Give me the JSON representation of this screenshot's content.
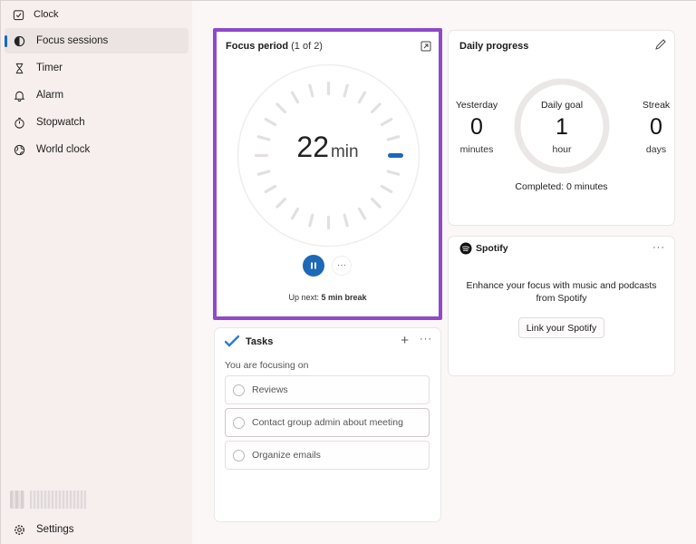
{
  "app": {
    "title": "Clock"
  },
  "window_controls": {
    "minimize": "minimize-icon",
    "maximize": "maximize-icon",
    "close": "close-icon"
  },
  "sidebar": {
    "items": [
      {
        "label": "Focus sessions",
        "icon": "focus-icon",
        "active": true
      },
      {
        "label": "Timer",
        "icon": "hourglass-icon"
      },
      {
        "label": "Alarm",
        "icon": "bell-icon"
      },
      {
        "label": "Stopwatch",
        "icon": "stopwatch-icon"
      },
      {
        "label": "World clock",
        "icon": "globe-icon"
      }
    ],
    "settings_label": "Settings"
  },
  "focus": {
    "title": "Focus period",
    "subtitle": "(1 of 2)",
    "minutes": "22",
    "unit": "min",
    "upnext_prefix": "Up next:",
    "upnext_value": "5 min break",
    "more_label": "···",
    "accent": "#1d68b8",
    "highlight_color": "#8f49c9"
  },
  "daily_progress": {
    "title": "Daily progress",
    "yesterday": {
      "label": "Yesterday",
      "value": "0",
      "unit": "minutes"
    },
    "goal": {
      "label": "Daily goal",
      "value": "1",
      "unit": "hour"
    },
    "streak": {
      "label": "Streak",
      "value": "0",
      "unit": "days"
    },
    "completed": "Completed: 0 minutes",
    "goal_fraction": 0
  },
  "spotify": {
    "title": "Spotify",
    "description": "Enhance your focus with music and podcasts from Spotify",
    "button_label": "Link your Spotify",
    "more_label": "···"
  },
  "tasks": {
    "title": "Tasks",
    "add_label": "+",
    "more_label": "···",
    "focusing_label": "You are focusing on",
    "items": [
      {
        "label": "Reviews"
      },
      {
        "label": "Contact group admin about meeting"
      },
      {
        "label": "Organize emails"
      }
    ]
  }
}
